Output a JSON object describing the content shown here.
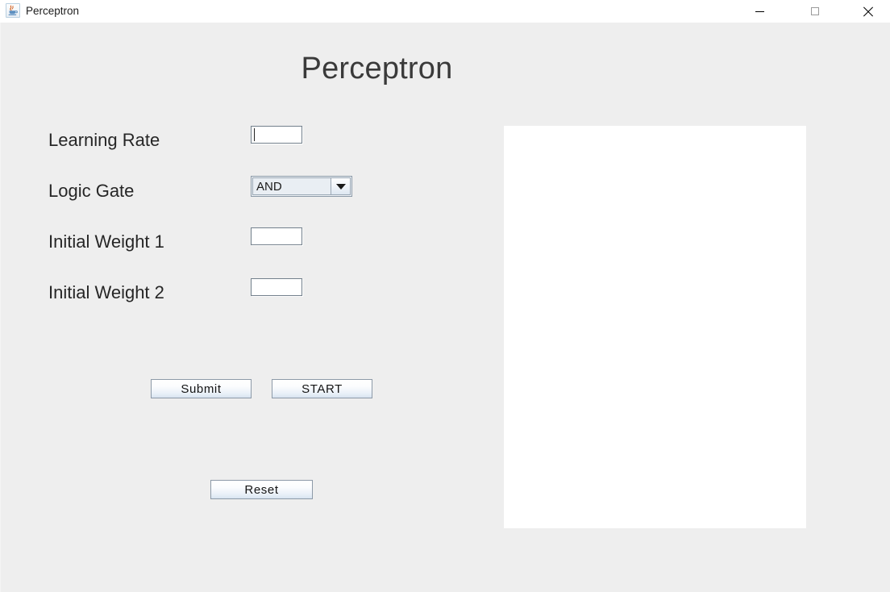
{
  "window": {
    "title": "Perceptron",
    "icon": "java-coffee-cup-icon",
    "controls": {
      "minimize_label": "Minimize",
      "maximize_label": "Maximize",
      "close_label": "Close"
    }
  },
  "main": {
    "heading": "Perceptron",
    "fields": [
      {
        "label": "Learning Rate",
        "type": "text",
        "value": "",
        "focused": true
      },
      {
        "label": "Logic Gate",
        "type": "combobox",
        "value": "AND",
        "focused": false
      },
      {
        "label": "Initial Weight 1",
        "type": "text",
        "value": "",
        "focused": false
      },
      {
        "label": "Initial Weight 2",
        "type": "text",
        "value": "",
        "focused": false
      }
    ],
    "buttons": {
      "submit": "Submit",
      "start": "START",
      "reset": "Reset"
    },
    "output_panel": {
      "content": ""
    }
  },
  "colors": {
    "window_background": "#eeeeee",
    "titlebar_background": "#ffffff",
    "heading_text": "#3a3a3a",
    "label_text": "#262626",
    "field_border": "#73808c",
    "button_border": "#8d9aa8",
    "output_panel_background": "#ffffff"
  }
}
